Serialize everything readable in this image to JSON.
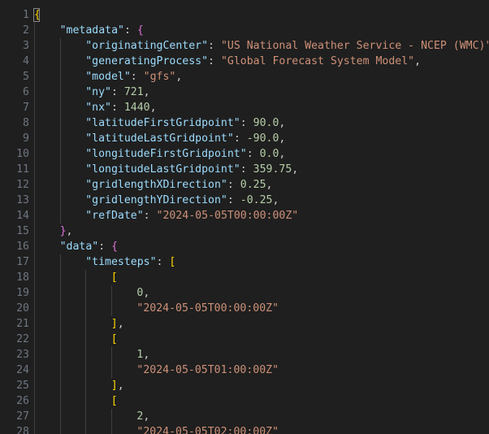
{
  "line_numbers": [
    "1",
    "2",
    "3",
    "4",
    "5",
    "6",
    "7",
    "8",
    "9",
    "10",
    "11",
    "12",
    "13",
    "14",
    "15",
    "16",
    "17",
    "18",
    "19",
    "20",
    "21",
    "22",
    "23",
    "24",
    "25",
    "26",
    "27",
    "28"
  ],
  "lines": [
    {
      "indent": 0,
      "tokens": [
        {
          "t": "brace",
          "v": "{"
        }
      ]
    },
    {
      "indent": 1,
      "tokens": [
        {
          "t": "key",
          "v": "\"metadata\""
        },
        {
          "t": "punc",
          "v": ": "
        },
        {
          "t": "bracket",
          "v": "{"
        }
      ]
    },
    {
      "indent": 2,
      "tokens": [
        {
          "t": "key",
          "v": "\"originatingCenter\""
        },
        {
          "t": "punc",
          "v": ": "
        },
        {
          "t": "str",
          "v": "\"US National Weather Service - NCEP (WMC)\""
        },
        {
          "t": "punc",
          "v": ","
        }
      ]
    },
    {
      "indent": 2,
      "tokens": [
        {
          "t": "key",
          "v": "\"generatingProcess\""
        },
        {
          "t": "punc",
          "v": ": "
        },
        {
          "t": "str",
          "v": "\"Global Forecast System Model\""
        },
        {
          "t": "punc",
          "v": ","
        }
      ]
    },
    {
      "indent": 2,
      "tokens": [
        {
          "t": "key",
          "v": "\"model\""
        },
        {
          "t": "punc",
          "v": ": "
        },
        {
          "t": "str",
          "v": "\"gfs\""
        },
        {
          "t": "punc",
          "v": ","
        }
      ]
    },
    {
      "indent": 2,
      "tokens": [
        {
          "t": "key",
          "v": "\"ny\""
        },
        {
          "t": "punc",
          "v": ": "
        },
        {
          "t": "num",
          "v": "721"
        },
        {
          "t": "punc",
          "v": ","
        }
      ]
    },
    {
      "indent": 2,
      "tokens": [
        {
          "t": "key",
          "v": "\"nx\""
        },
        {
          "t": "punc",
          "v": ": "
        },
        {
          "t": "num",
          "v": "1440"
        },
        {
          "t": "punc",
          "v": ","
        }
      ]
    },
    {
      "indent": 2,
      "tokens": [
        {
          "t": "key",
          "v": "\"latitudeFirstGridpoint\""
        },
        {
          "t": "punc",
          "v": ": "
        },
        {
          "t": "num",
          "v": "90.0"
        },
        {
          "t": "punc",
          "v": ","
        }
      ]
    },
    {
      "indent": 2,
      "tokens": [
        {
          "t": "key",
          "v": "\"latitudeLastGridpoint\""
        },
        {
          "t": "punc",
          "v": ": "
        },
        {
          "t": "num",
          "v": "-90.0"
        },
        {
          "t": "punc",
          "v": ","
        }
      ]
    },
    {
      "indent": 2,
      "tokens": [
        {
          "t": "key",
          "v": "\"longitudeFirstGridpoint\""
        },
        {
          "t": "punc",
          "v": ": "
        },
        {
          "t": "num",
          "v": "0.0"
        },
        {
          "t": "punc",
          "v": ","
        }
      ]
    },
    {
      "indent": 2,
      "tokens": [
        {
          "t": "key",
          "v": "\"longitudeLastGridpoint\""
        },
        {
          "t": "punc",
          "v": ": "
        },
        {
          "t": "num",
          "v": "359.75"
        },
        {
          "t": "punc",
          "v": ","
        }
      ]
    },
    {
      "indent": 2,
      "tokens": [
        {
          "t": "key",
          "v": "\"gridlengthXDirection\""
        },
        {
          "t": "punc",
          "v": ": "
        },
        {
          "t": "num",
          "v": "0.25"
        },
        {
          "t": "punc",
          "v": ","
        }
      ]
    },
    {
      "indent": 2,
      "tokens": [
        {
          "t": "key",
          "v": "\"gridlengthYDirection\""
        },
        {
          "t": "punc",
          "v": ": "
        },
        {
          "t": "num",
          "v": "-0.25"
        },
        {
          "t": "punc",
          "v": ","
        }
      ]
    },
    {
      "indent": 2,
      "tokens": [
        {
          "t": "key",
          "v": "\"refDate\""
        },
        {
          "t": "punc",
          "v": ": "
        },
        {
          "t": "str",
          "v": "\"2024-05-05T00:00:00Z\""
        }
      ]
    },
    {
      "indent": 1,
      "tokens": [
        {
          "t": "bracket",
          "v": "}"
        },
        {
          "t": "punc",
          "v": ","
        }
      ]
    },
    {
      "indent": 1,
      "tokens": [
        {
          "t": "key",
          "v": "\"data\""
        },
        {
          "t": "punc",
          "v": ": "
        },
        {
          "t": "bracket",
          "v": "{"
        }
      ]
    },
    {
      "indent": 2,
      "tokens": [
        {
          "t": "key",
          "v": "\"timesteps\""
        },
        {
          "t": "punc",
          "v": ": "
        },
        {
          "t": "brace",
          "v": "["
        }
      ]
    },
    {
      "indent": 3,
      "tokens": [
        {
          "t": "brace",
          "v": "["
        }
      ]
    },
    {
      "indent": 4,
      "tokens": [
        {
          "t": "num",
          "v": "0"
        },
        {
          "t": "punc",
          "v": ","
        }
      ]
    },
    {
      "indent": 4,
      "tokens": [
        {
          "t": "str",
          "v": "\"2024-05-05T00:00:00Z\""
        }
      ]
    },
    {
      "indent": 3,
      "tokens": [
        {
          "t": "brace",
          "v": "]"
        },
        {
          "t": "punc",
          "v": ","
        }
      ]
    },
    {
      "indent": 3,
      "tokens": [
        {
          "t": "brace",
          "v": "["
        }
      ]
    },
    {
      "indent": 4,
      "tokens": [
        {
          "t": "num",
          "v": "1"
        },
        {
          "t": "punc",
          "v": ","
        }
      ]
    },
    {
      "indent": 4,
      "tokens": [
        {
          "t": "str",
          "v": "\"2024-05-05T01:00:00Z\""
        }
      ]
    },
    {
      "indent": 3,
      "tokens": [
        {
          "t": "brace",
          "v": "]"
        },
        {
          "t": "punc",
          "v": ","
        }
      ]
    },
    {
      "indent": 3,
      "tokens": [
        {
          "t": "brace",
          "v": "["
        }
      ]
    },
    {
      "indent": 4,
      "tokens": [
        {
          "t": "num",
          "v": "2"
        },
        {
          "t": "punc",
          "v": ","
        }
      ]
    },
    {
      "indent": 4,
      "tokens": [
        {
          "t": "str",
          "v": "\"2024-05-05T02:00:00Z\""
        }
      ]
    }
  ],
  "colors": {
    "background": "#1f1f1f",
    "line_number": "#6e7681",
    "key": "#9cdcfe",
    "string": "#ce9178",
    "number": "#b5cea8",
    "punctuation": "#cccccc",
    "bracket_level1": "#ffd700",
    "bracket_level2": "#da70d6"
  }
}
